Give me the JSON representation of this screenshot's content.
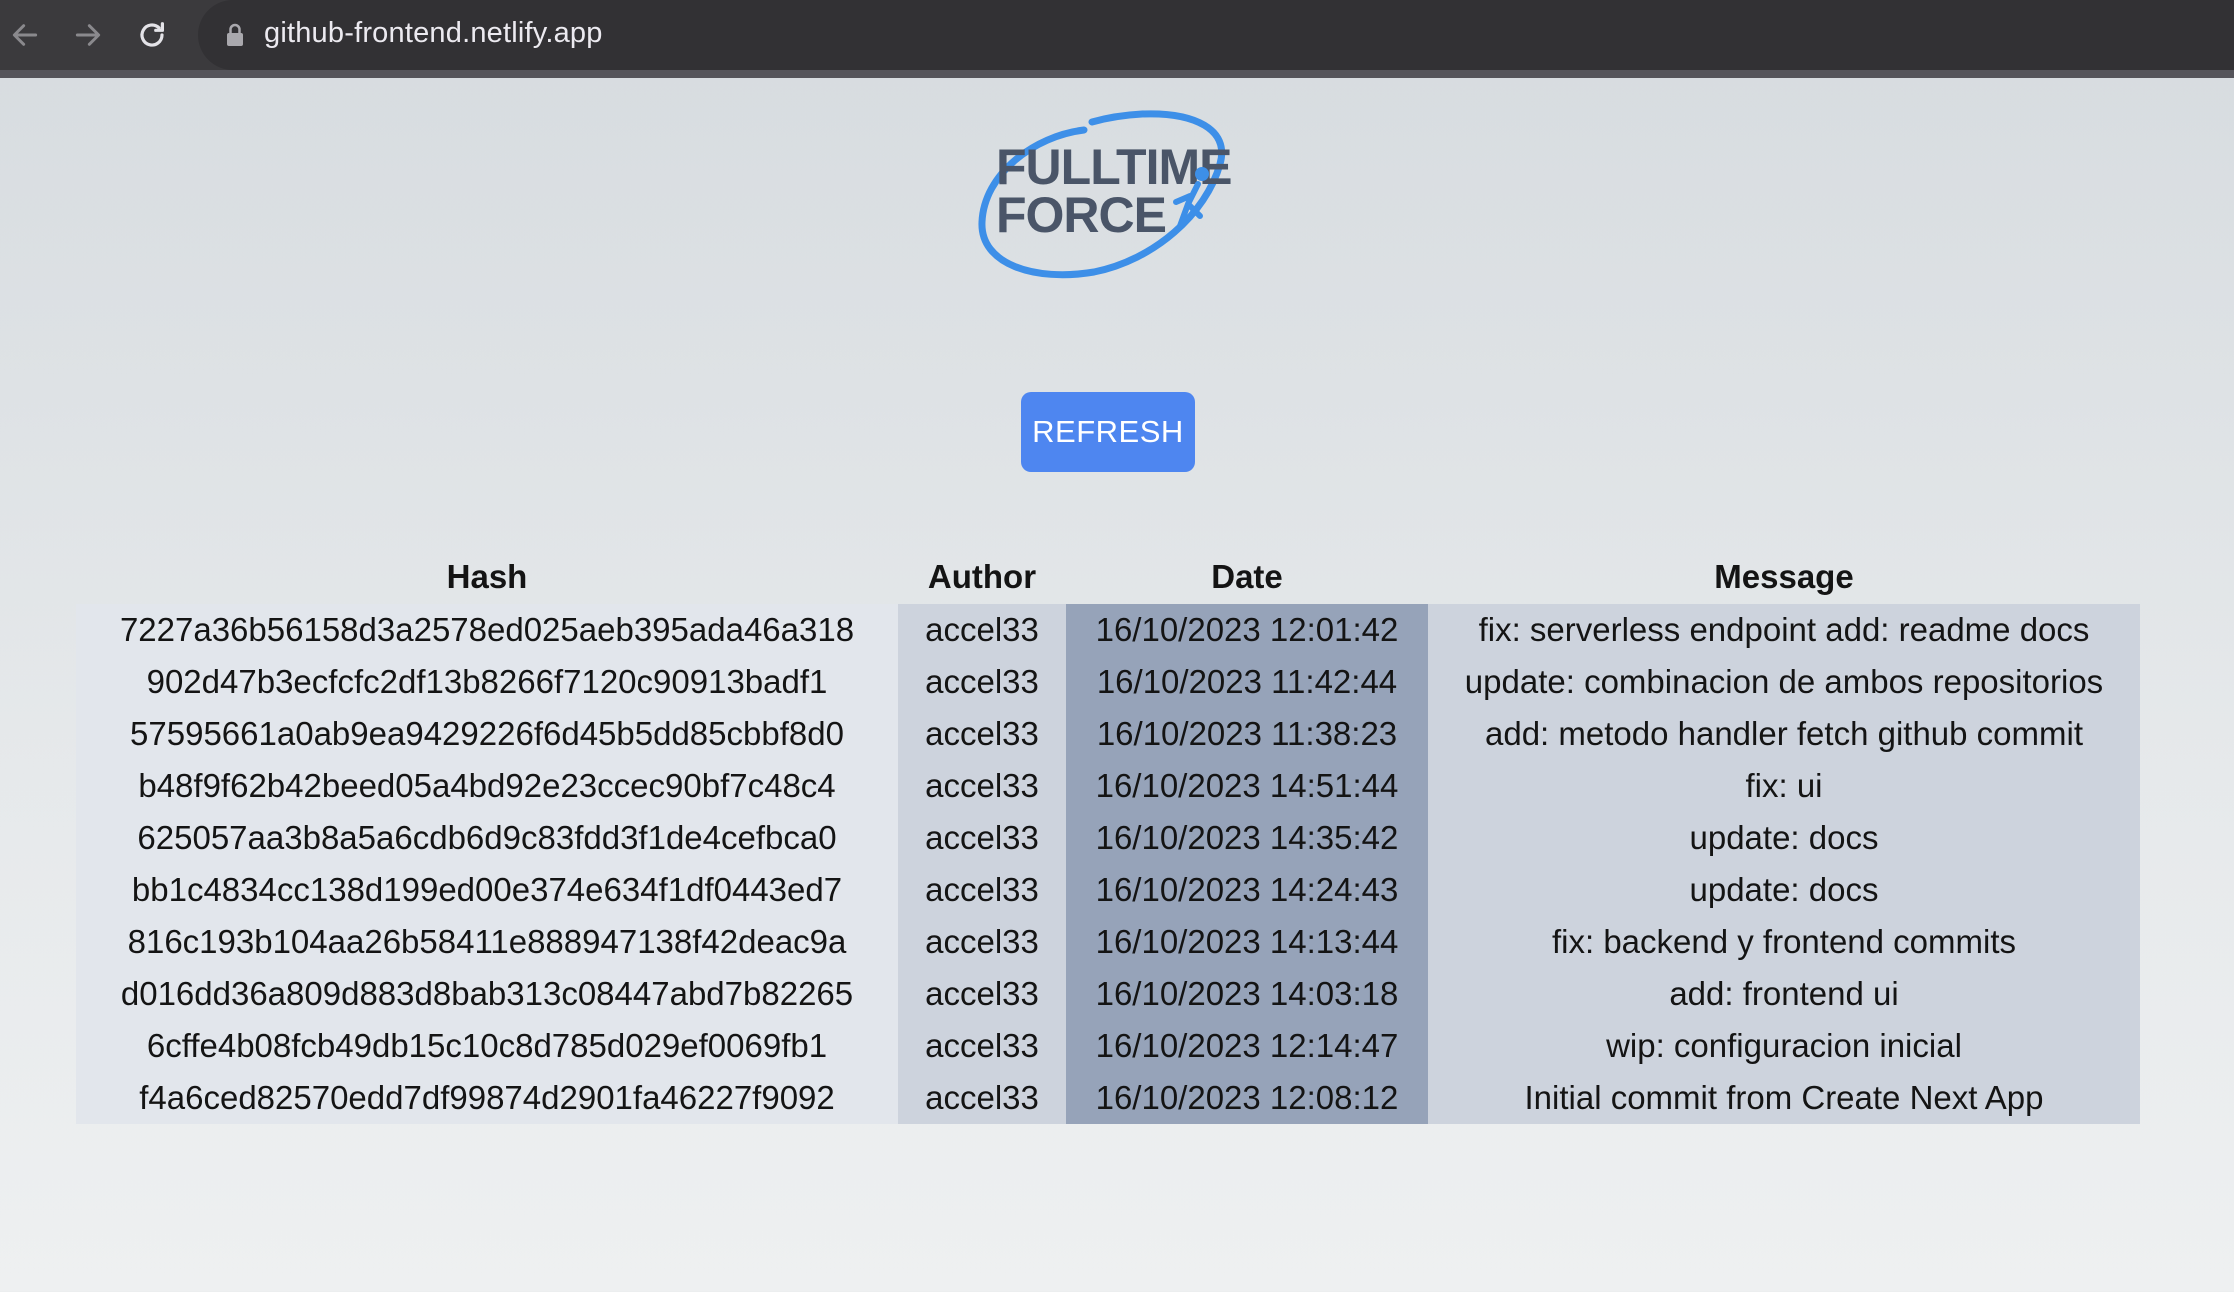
{
  "browser": {
    "url": "github-frontend.netlify.app",
    "icons": {
      "back": "arrow-left-icon",
      "forward": "arrow-right-icon",
      "reload": "reload-icon",
      "lock": "lock-icon"
    }
  },
  "logo": {
    "line1": "FULLTIME",
    "line2": "FORCE",
    "accent": "#3d8fe8",
    "text_color": "#4a5568"
  },
  "refresh_button": {
    "label": "REFRESH",
    "color": "#4e86f0"
  },
  "table": {
    "headers": [
      "Hash",
      "Author",
      "Date",
      "Message"
    ],
    "rows": [
      {
        "hash": "7227a36b56158d3a2578ed025aeb395ada46a318",
        "author": "accel33",
        "date": "16/10/2023 12:01:42",
        "message": "fix: serverless endpoint add: readme docs"
      },
      {
        "hash": "902d47b3ecfcfc2df13b8266f7120c90913badf1",
        "author": "accel33",
        "date": "16/10/2023 11:42:44",
        "message": "update: combinacion de ambos repositorios"
      },
      {
        "hash": "57595661a0ab9ea9429226f6d45b5dd85cbbf8d0",
        "author": "accel33",
        "date": "16/10/2023 11:38:23",
        "message": "add: metodo handler fetch github commit"
      },
      {
        "hash": "b48f9f62b42beed05a4bd92e23ccec90bf7c48c4",
        "author": "accel33",
        "date": "16/10/2023 14:51:44",
        "message": "fix: ui"
      },
      {
        "hash": "625057aa3b8a5a6cdb6d9c83fdd3f1de4cefbca0",
        "author": "accel33",
        "date": "16/10/2023 14:35:42",
        "message": "update: docs"
      },
      {
        "hash": "bb1c4834cc138d199ed00e374e634f1df0443ed7",
        "author": "accel33",
        "date": "16/10/2023 14:24:43",
        "message": "update: docs"
      },
      {
        "hash": "816c193b104aa26b58411e888947138f42deac9a",
        "author": "accel33",
        "date": "16/10/2023 14:13:44",
        "message": "fix: backend y frontend commits"
      },
      {
        "hash": "d016dd36a809d883d8bab313c08447abd7b82265",
        "author": "accel33",
        "date": "16/10/2023 14:03:18",
        "message": "add: frontend ui"
      },
      {
        "hash": "6cffe4b08fcb49db15c10c8d785d029ef0069fb1",
        "author": "accel33",
        "date": "16/10/2023 12:14:47",
        "message": "wip: configuracion inicial"
      },
      {
        "hash": "f4a6ced82570edd7df99874d2901fa46227f9092",
        "author": "accel33",
        "date": "16/10/2023 12:08:12",
        "message": "Initial commit from Create Next App"
      }
    ],
    "column_colors": {
      "hash": "#e2e6ec",
      "author": "#cdd3dd",
      "date": "#96a3b9",
      "message": "#cdd3dd"
    }
  }
}
